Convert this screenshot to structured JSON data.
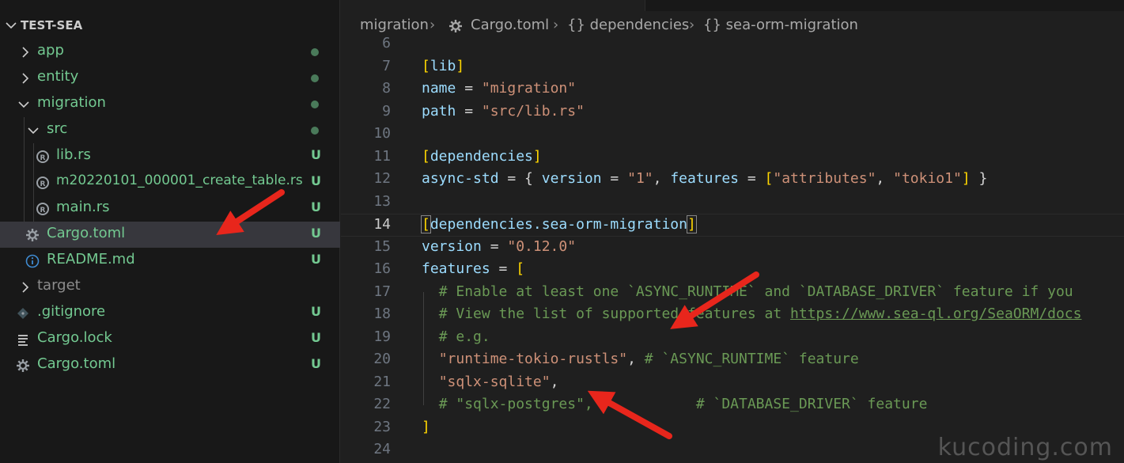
{
  "explorer": {
    "root": "TEST-SEA",
    "items": [
      {
        "name": "app",
        "status": ""
      },
      {
        "name": "entity",
        "status": ""
      },
      {
        "name": "migration",
        "status": ""
      },
      {
        "name": "src",
        "status": ""
      },
      {
        "name": "lib.rs",
        "status": "U"
      },
      {
        "name": "m20220101_000001_create_table.rs",
        "status": "U"
      },
      {
        "name": "main.rs",
        "status": "U"
      },
      {
        "name": "Cargo.toml",
        "status": "U"
      },
      {
        "name": "README.md",
        "status": "U"
      },
      {
        "name": "target",
        "status": ""
      },
      {
        "name": ".gitignore",
        "status": "U"
      },
      {
        "name": "Cargo.lock",
        "status": "U"
      },
      {
        "name": "Cargo.toml",
        "status": "U"
      }
    ]
  },
  "breadcrumb": {
    "folder": "migration",
    "file": "Cargo.toml",
    "section1": "{} dependencies",
    "section2": "{} sea-orm-migration"
  },
  "editor": {
    "current_line": 14,
    "line_numbers": [
      "6",
      "7",
      "8",
      "9",
      "10",
      "11",
      "12",
      "13",
      "14",
      "15",
      "16",
      "17",
      "18",
      "19",
      "20",
      "21",
      "22",
      "23",
      "24"
    ],
    "lines": {
      "l7": "lib",
      "l8_key": "name",
      "l8_val": "\"migration\"",
      "l9_key": "path",
      "l9_val": "\"src/lib.rs\"",
      "l11": "dependencies",
      "l12_key": "async-std",
      "l12_vkey": "version",
      "l12_vval": "\"1\"",
      "l12_fkey": "features",
      "l12_f1": "\"attributes\"",
      "l12_f2": "\"tokio1\"",
      "l14": "dependencies.sea-orm-migration",
      "l15_key": "version",
      "l15_val": "\"0.12.0\"",
      "l16_key": "features",
      "l17": "# Enable at least one `ASYNC_RUNTIME` and `DATABASE_DRIVER` feature if you",
      "l18_pre": "# View the list of supported features at ",
      "l18_link": "https://www.sea-ql.org/SeaORM/docs",
      "l19": "# e.g.",
      "l20_str": "\"runtime-tokio-rustls\"",
      "l20_cm": "# `ASYNC_RUNTIME` feature",
      "l21_str": "\"sqlx-sqlite\"",
      "l22_cm1": "# \"sqlx-postgres\",",
      "l22_cm2": "# `DATABASE_DRIVER` feature"
    }
  },
  "watermark": "kucoding.com",
  "colors": {
    "untracked": "#73c991",
    "arrow": "#e8261c",
    "string": "#ce9178",
    "key": "#9cdcfe",
    "bracket": "#ffd700",
    "comment": "#6a9955"
  }
}
